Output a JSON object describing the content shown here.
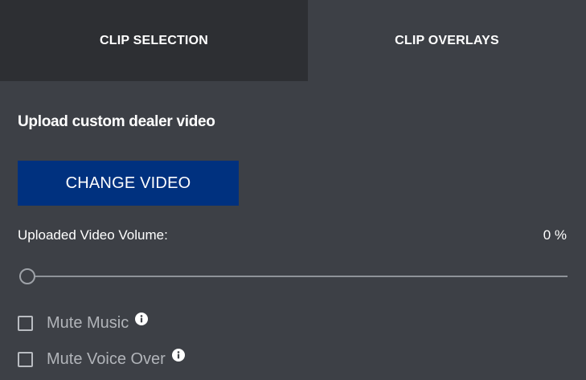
{
  "tabs": {
    "clip_selection": "CLIP SELECTION",
    "clip_overlays": "CLIP OVERLAYS"
  },
  "upload": {
    "heading": "Upload custom dealer video",
    "button_label": "CHANGE VIDEO"
  },
  "volume": {
    "label": "Uploaded Video Volume:",
    "value_text": "0 %",
    "value": 0
  },
  "options": {
    "mute_music": {
      "label": "Mute Music",
      "checked": false,
      "icon": "info-icon"
    },
    "mute_voice_over": {
      "label": "Mute Voice Over",
      "checked": false,
      "icon": "info-icon"
    }
  },
  "colors": {
    "panel_bg": "#3d4046",
    "selected_tab_bg": "#2d2f33",
    "button_bg": "#00317f",
    "text": "#ffffff",
    "muted_text": "#b1b4b9"
  }
}
